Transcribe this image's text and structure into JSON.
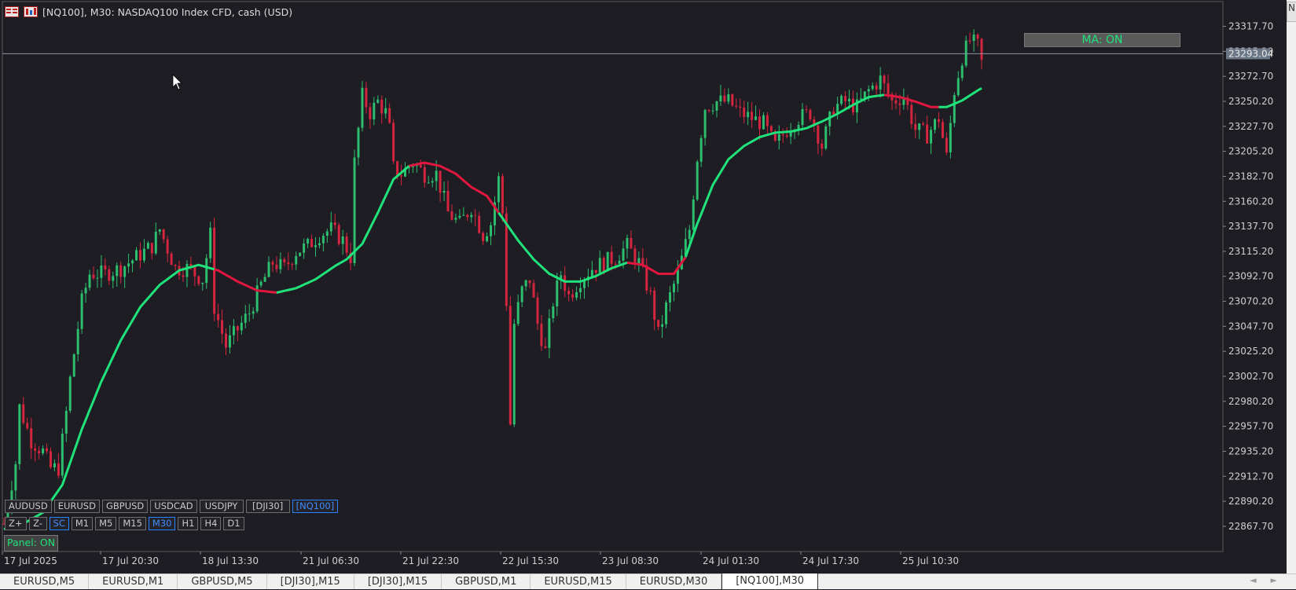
{
  "window": {
    "title": "[NQ100], M30:  NASDAQ100 Index CFD, cash (USD)"
  },
  "colors": {
    "background": "#1f1d24",
    "bull": "#2bbf6e",
    "bear": "#d6263f",
    "ma_up": "#1fe37a",
    "ma_down": "#e0173e",
    "axis_text": "#cfcfcf",
    "accent": "#2a82ff"
  },
  "indicator": {
    "ma_button_label": "MA: ON",
    "panel_label": "Panel: ON"
  },
  "symbol_buttons": [
    {
      "label": "AUDUSD",
      "active": false
    },
    {
      "label": "EURUSD",
      "active": false
    },
    {
      "label": "GBPUSD",
      "active": false
    },
    {
      "label": "USDCAD",
      "active": false
    },
    {
      "label": "USDJPY",
      "active": false
    },
    {
      "label": "[DJI30]",
      "active": false
    },
    {
      "label": "[NQ100]",
      "active": true
    }
  ],
  "timeframe_buttons": [
    {
      "label": "Z+",
      "active": false
    },
    {
      "label": "Z-",
      "active": false
    },
    {
      "label": "SC",
      "active": true
    },
    {
      "label": "M1",
      "active": false
    },
    {
      "label": "M5",
      "active": false
    },
    {
      "label": "M15",
      "active": false
    },
    {
      "label": "M30",
      "active": true
    },
    {
      "label": "H1",
      "active": false
    },
    {
      "label": "H4",
      "active": false
    },
    {
      "label": "D1",
      "active": false
    }
  ],
  "tabs": [
    {
      "label": "EURUSD,M5",
      "active": false
    },
    {
      "label": "EURUSD,M1",
      "active": false
    },
    {
      "label": "GBPUSD,M5",
      "active": false
    },
    {
      "label": "[DJI30],M15",
      "active": false
    },
    {
      "label": "[DJI30],M15",
      "active": false
    },
    {
      "label": "GBPUSD,M1",
      "active": false
    },
    {
      "label": "EURUSD,M15",
      "active": false
    },
    {
      "label": "EURUSD,M30",
      "active": false
    },
    {
      "label": "[NQ100],M30",
      "active": true
    }
  ],
  "right_strip_peek": "N",
  "chart_data": {
    "type": "candlestick",
    "symbol": "[NQ100]",
    "timeframe": "M30",
    "current_price": "23293.04",
    "ylim": [
      22845,
      23340
    ],
    "y_ticks": [
      "23317.70",
      "23295.20",
      "23272.70",
      "23250.20",
      "23227.70",
      "23205.20",
      "23182.70",
      "23160.20",
      "23137.70",
      "23115.20",
      "23092.70",
      "23070.20",
      "23047.70",
      "23025.20",
      "23002.70",
      "22980.20",
      "22957.70",
      "22935.20",
      "22912.70",
      "22890.20",
      "22867.70"
    ],
    "x_ticks": [
      "17 Jul 2025",
      "17 Jul 20:30",
      "18 Jul 13:30",
      "21 Jul 06:30",
      "21 Jul 22:30",
      "22 Jul 15:30",
      "23 Jul 08:30",
      "24 Jul 01:30",
      "24 Jul 17:30",
      "25 Jul 10:30"
    ],
    "close_path": [
      [
        0,
        22870
      ],
      [
        3,
        22925
      ],
      [
        4,
        22975
      ],
      [
        7,
        22945
      ],
      [
        10,
        22935
      ],
      [
        12,
        22920
      ],
      [
        14,
        22920
      ],
      [
        16,
        22970
      ],
      [
        17,
        23000
      ],
      [
        20,
        23070
      ],
      [
        22,
        23095
      ],
      [
        26,
        23095
      ],
      [
        30,
        23100
      ],
      [
        34,
        23110
      ],
      [
        38,
        23120
      ],
      [
        40,
        23135
      ],
      [
        44,
        23100
      ],
      [
        47,
        23100
      ],
      [
        51,
        23090
      ],
      [
        53,
        23130
      ],
      [
        54,
        23065
      ],
      [
        57,
        23030
      ],
      [
        60,
        23045
      ],
      [
        63,
        23060
      ],
      [
        66,
        23085
      ],
      [
        69,
        23105
      ],
      [
        72,
        23100
      ],
      [
        75,
        23115
      ],
      [
        78,
        23120
      ],
      [
        81,
        23130
      ],
      [
        84,
        23135
      ],
      [
        87,
        23125
      ],
      [
        89,
        23110
      ],
      [
        90,
        23195
      ],
      [
        92,
        23255
      ],
      [
        94,
        23240
      ],
      [
        96,
        23250
      ],
      [
        98,
        23240
      ],
      [
        99,
        23225
      ],
      [
        100,
        23190
      ],
      [
        102,
        23185
      ],
      [
        105,
        23195
      ],
      [
        108,
        23185
      ],
      [
        111,
        23185
      ],
      [
        114,
        23150
      ],
      [
        117,
        23140
      ],
      [
        120,
        23155
      ],
      [
        123,
        23130
      ],
      [
        125,
        23140
      ],
      [
        127,
        23180
      ],
      [
        128,
        23150
      ],
      [
        129,
        23070
      ],
      [
        130,
        22960
      ],
      [
        131,
        23050
      ],
      [
        133,
        23080
      ],
      [
        135,
        23090
      ],
      [
        137,
        23050
      ],
      [
        139,
        23025
      ],
      [
        141,
        23070
      ],
      [
        143,
        23095
      ],
      [
        145,
        23075
      ],
      [
        148,
        23090
      ],
      [
        151,
        23100
      ],
      [
        154,
        23105
      ],
      [
        157,
        23110
      ],
      [
        160,
        23120
      ],
      [
        163,
        23105
      ],
      [
        166,
        23075
      ],
      [
        168,
        23040
      ],
      [
        170,
        23065
      ],
      [
        173,
        23095
      ],
      [
        176,
        23135
      ],
      [
        178,
        23200
      ],
      [
        180,
        23245
      ],
      [
        183,
        23250
      ],
      [
        186,
        23250
      ],
      [
        189,
        23240
      ],
      [
        192,
        23235
      ],
      [
        195,
        23230
      ],
      [
        198,
        23210
      ],
      [
        201,
        23225
      ],
      [
        204,
        23235
      ],
      [
        207,
        23240
      ],
      [
        210,
        23210
      ],
      [
        213,
        23245
      ],
      [
        216,
        23250
      ],
      [
        219,
        23245
      ],
      [
        222,
        23260
      ],
      [
        225,
        23270
      ],
      [
        228,
        23250
      ],
      [
        231,
        23255
      ],
      [
        234,
        23225
      ],
      [
        237,
        23220
      ],
      [
        240,
        23235
      ],
      [
        242,
        23200
      ],
      [
        244,
        23260
      ],
      [
        246,
        23290
      ],
      [
        248,
        23305
      ],
      [
        250,
        23300
      ],
      [
        251,
        23285
      ]
    ],
    "ma_path": [
      [
        0,
        22865
      ],
      [
        5,
        22870
      ],
      [
        10,
        22880
      ],
      [
        15,
        22905
      ],
      [
        20,
        22955
      ],
      [
        25,
        22998
      ],
      [
        30,
        23035
      ],
      [
        35,
        23065
      ],
      [
        40,
        23085
      ],
      [
        45,
        23098
      ],
      [
        50,
        23103
      ],
      [
        55,
        23098
      ],
      [
        60,
        23088
      ],
      [
        65,
        23080
      ],
      [
        70,
        23078
      ],
      [
        75,
        23082
      ],
      [
        80,
        23090
      ],
      [
        85,
        23102
      ],
      [
        88,
        23108
      ],
      [
        92,
        23122
      ],
      [
        96,
        23150
      ],
      [
        100,
        23180
      ],
      [
        104,
        23192
      ],
      [
        108,
        23195
      ],
      [
        112,
        23192
      ],
      [
        116,
        23185
      ],
      [
        120,
        23173
      ],
      [
        124,
        23165
      ],
      [
        128,
        23145
      ],
      [
        132,
        23125
      ],
      [
        136,
        23108
      ],
      [
        140,
        23095
      ],
      [
        144,
        23088
      ],
      [
        148,
        23088
      ],
      [
        152,
        23093
      ],
      [
        156,
        23100
      ],
      [
        160,
        23105
      ],
      [
        164,
        23103
      ],
      [
        168,
        23095
      ],
      [
        172,
        23095
      ],
      [
        175,
        23110
      ],
      [
        178,
        23140
      ],
      [
        182,
        23175
      ],
      [
        186,
        23198
      ],
      [
        190,
        23210
      ],
      [
        194,
        23218
      ],
      [
        198,
        23222
      ],
      [
        202,
        23223
      ],
      [
        206,
        23226
      ],
      [
        210,
        23232
      ],
      [
        214,
        23239
      ],
      [
        218,
        23247
      ],
      [
        222,
        23254
      ],
      [
        226,
        23256
      ],
      [
        230,
        23254
      ],
      [
        234,
        23250
      ],
      [
        238,
        23245
      ],
      [
        242,
        23245
      ],
      [
        246,
        23251
      ],
      [
        250,
        23260
      ],
      [
        251,
        23262
      ]
    ],
    "ma_bear_ranges": [
      [
        54,
        70
      ],
      [
        104,
        127
      ],
      [
        160,
        175
      ],
      [
        226,
        240
      ]
    ]
  }
}
